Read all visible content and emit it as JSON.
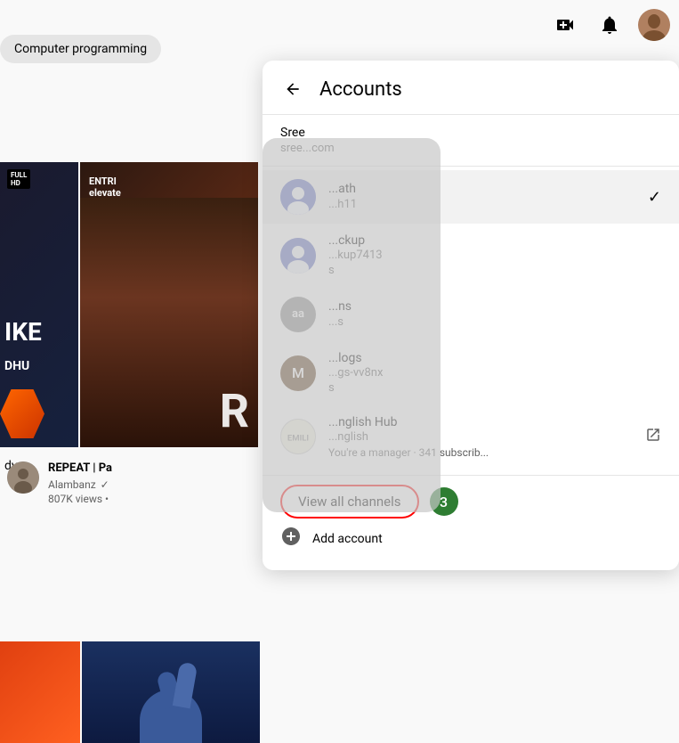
{
  "topbar": {
    "create_icon": "video-plus",
    "bell_icon": "bell",
    "avatar_alt": "user avatar"
  },
  "search_chip": {
    "label": "Computer programming"
  },
  "background": {
    "video1": {
      "badge": "FULL HD",
      "partial_text": "KE"
    },
    "video2": {
      "label1": "ENTRI",
      "label2": "elevate",
      "letter": "R"
    },
    "video_meta": {
      "title": "REPEAT | Pa",
      "channel": "Alambanz",
      "verified": true,
      "views": "807K views •"
    },
    "left_label": "dy"
  },
  "panel": {
    "title": "Accounts",
    "back_label": "←",
    "top_account": {
      "name": "Sree",
      "email": "sree...com"
    },
    "accounts": [
      {
        "name": "...ath",
        "handle": "...h11",
        "avatar_color": "#5b6abf",
        "active": true,
        "show_check": true
      },
      {
        "name": "...ckup",
        "handle": "...kup7413",
        "extra": "s",
        "avatar_color": "#5b6abf",
        "active": false,
        "show_check": false
      },
      {
        "name": "...ns",
        "handle": "...s",
        "avatar_color": "#aaa",
        "letter": "aa",
        "active": false,
        "show_check": false
      },
      {
        "name": "...logs",
        "handle": "...gs-vv8nx",
        "extra": "s",
        "avatar_color": "#5d3a1a",
        "letter": "M",
        "active": false,
        "show_check": false
      },
      {
        "name": "...nglish Hub",
        "handle": "...nglish",
        "manager_note": "You're a manager · 341 subscrib...",
        "avatar_color": "#f5f5e0",
        "show_external": true,
        "active": false,
        "show_check": false
      }
    ],
    "footer": {
      "view_all_label": "View all channels",
      "count": "3",
      "add_account_label": "Add account"
    }
  }
}
